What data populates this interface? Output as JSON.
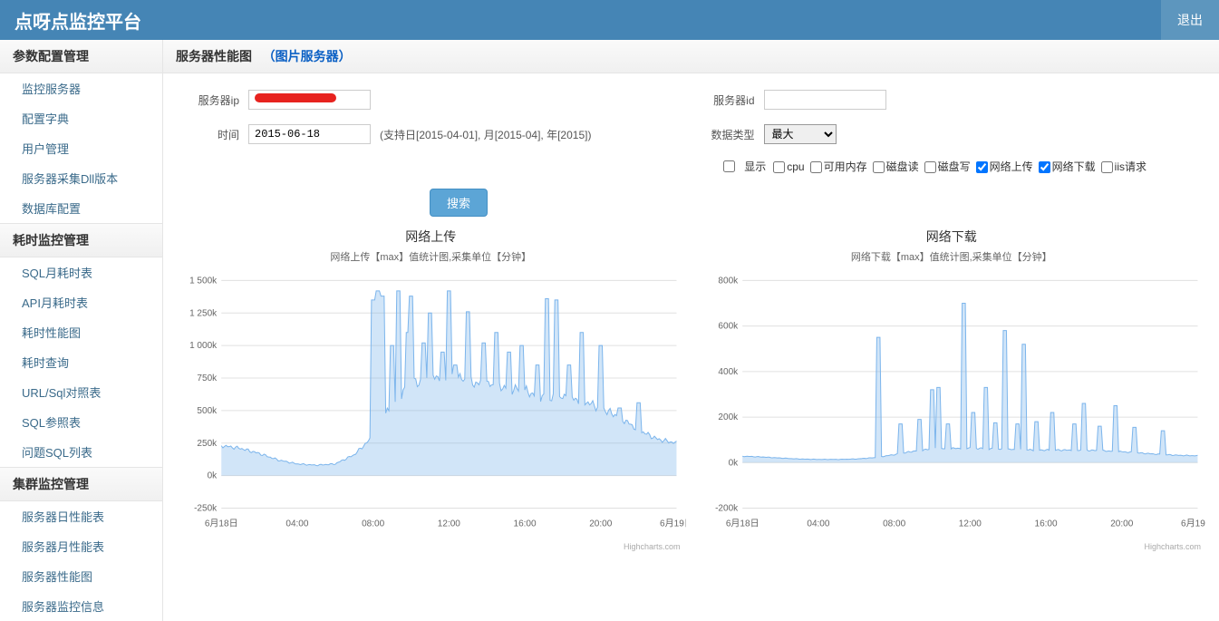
{
  "header": {
    "title": "点呀点监控平台",
    "logout": "退出"
  },
  "sidebar": {
    "sections": [
      {
        "head": "参数配置管理",
        "items": [
          "监控服务器",
          "配置字典",
          "用户管理",
          "服务器采集Dll版本",
          "数据库配置"
        ]
      },
      {
        "head": "耗时监控管理",
        "items": [
          "SQL月耗时表",
          "API月耗时表",
          "耗时性能图",
          "耗时查询",
          "URL/Sql对照表",
          "SQL参照表",
          "问题SQL列表"
        ]
      },
      {
        "head": "集群监控管理",
        "items": [
          "服务器日性能表",
          "服务器月性能表",
          "服务器性能图",
          "服务器监控信息"
        ]
      }
    ]
  },
  "page_title": {
    "main": "服务器性能图",
    "sub": "（图片服务器）"
  },
  "filters": {
    "server_ip_label": "服务器ip",
    "server_id_label": "服务器id",
    "server_id_value": "",
    "time_label": "时间",
    "time_value": "2015-06-18",
    "time_hint": "(支持日[2015-04-01], 月[2015-04], 年[2015])",
    "data_type_label": "数据类型",
    "data_type_value": "最大",
    "display_label": "显示",
    "show_top_checked": false,
    "metrics": [
      {
        "label": "cpu",
        "checked": false
      },
      {
        "label": "可用内存",
        "checked": false
      },
      {
        "label": "磁盘读",
        "checked": false
      },
      {
        "label": "磁盘写",
        "checked": false
      },
      {
        "label": "网络上传",
        "checked": true
      },
      {
        "label": "网络下载",
        "checked": true
      },
      {
        "label": "iis请求",
        "checked": false
      }
    ],
    "search_button": "搜索"
  },
  "chart_data": [
    {
      "type": "line",
      "title": "网络上传",
      "subtitle": "网络上传【max】值统计图,采集单位【分钟】",
      "xlabel": "",
      "ylabel": "",
      "ylim": [
        -250000,
        1500000
      ],
      "y_ticks_labels": [
        "-250k",
        "0k",
        "250k",
        "500k",
        "750k",
        "1 000k",
        "1 250k",
        "1 500k"
      ],
      "x_ticks_labels": [
        "6月18日",
        "04:00",
        "08:00",
        "12:00",
        "16:00",
        "20:00",
        "6月19日"
      ],
      "credit": "Highcharts.com",
      "x": [
        0,
        60,
        120,
        180,
        240,
        300,
        360,
        420,
        480,
        540,
        600,
        660,
        720,
        780,
        840,
        900,
        960,
        1020,
        1080,
        1140,
        1200,
        1260,
        1320,
        1380,
        1440
      ],
      "values": [
        230,
        210,
        170,
        120,
        90,
        80,
        90,
        160,
        300,
        550,
        700,
        750,
        780,
        720,
        700,
        680,
        650,
        600,
        600,
        580,
        520,
        450,
        350,
        280,
        250
      ],
      "spikes": [
        {
          "x": 480,
          "v": 1350
        },
        {
          "x": 495,
          "v": 1420
        },
        {
          "x": 510,
          "v": 1380
        },
        {
          "x": 540,
          "v": 1000
        },
        {
          "x": 560,
          "v": 1420
        },
        {
          "x": 590,
          "v": 1100
        },
        {
          "x": 600,
          "v": 1380
        },
        {
          "x": 640,
          "v": 1020
        },
        {
          "x": 660,
          "v": 1250
        },
        {
          "x": 700,
          "v": 950
        },
        {
          "x": 720,
          "v": 1420
        },
        {
          "x": 740,
          "v": 850
        },
        {
          "x": 780,
          "v": 1260
        },
        {
          "x": 830,
          "v": 1020
        },
        {
          "x": 870,
          "v": 1100
        },
        {
          "x": 910,
          "v": 950
        },
        {
          "x": 950,
          "v": 1000
        },
        {
          "x": 1000,
          "v": 850
        },
        {
          "x": 1030,
          "v": 1360
        },
        {
          "x": 1060,
          "v": 1350
        },
        {
          "x": 1100,
          "v": 850
        },
        {
          "x": 1140,
          "v": 1100
        },
        {
          "x": 1200,
          "v": 1000
        },
        {
          "x": 1260,
          "v": 520
        },
        {
          "x": 1320,
          "v": 560
        }
      ]
    },
    {
      "type": "line",
      "title": "网络下载",
      "subtitle": "网络下载【max】值统计图,采集单位【分钟】",
      "xlabel": "",
      "ylabel": "",
      "ylim": [
        -200000,
        800000
      ],
      "y_ticks_labels": [
        "-200k",
        "0k",
        "200k",
        "400k",
        "600k",
        "800k"
      ],
      "x_ticks_labels": [
        "6月18日",
        "04:00",
        "08:00",
        "12:00",
        "16:00",
        "20:00",
        "6月19日"
      ],
      "credit": "Highcharts.com",
      "x": [
        0,
        60,
        120,
        180,
        240,
        300,
        360,
        420,
        480,
        540,
        600,
        660,
        720,
        780,
        840,
        900,
        960,
        1020,
        1080,
        1140,
        1200,
        1260,
        1320,
        1380,
        1440
      ],
      "values": [
        28,
        25,
        20,
        16,
        14,
        14,
        16,
        22,
        35,
        50,
        60,
        62,
        65,
        60,
        58,
        56,
        55,
        55,
        55,
        52,
        48,
        42,
        36,
        32,
        30
      ],
      "spikes": [
        {
          "x": 430,
          "v": 550
        },
        {
          "x": 500,
          "v": 170
        },
        {
          "x": 560,
          "v": 190
        },
        {
          "x": 600,
          "v": 320
        },
        {
          "x": 620,
          "v": 330
        },
        {
          "x": 650,
          "v": 170
        },
        {
          "x": 700,
          "v": 700
        },
        {
          "x": 730,
          "v": 220
        },
        {
          "x": 770,
          "v": 330
        },
        {
          "x": 800,
          "v": 175
        },
        {
          "x": 830,
          "v": 580
        },
        {
          "x": 870,
          "v": 170
        },
        {
          "x": 890,
          "v": 520
        },
        {
          "x": 930,
          "v": 180
        },
        {
          "x": 980,
          "v": 220
        },
        {
          "x": 1050,
          "v": 170
        },
        {
          "x": 1080,
          "v": 260
        },
        {
          "x": 1130,
          "v": 160
        },
        {
          "x": 1180,
          "v": 250
        },
        {
          "x": 1240,
          "v": 155
        },
        {
          "x": 1330,
          "v": 140
        }
      ]
    }
  ]
}
